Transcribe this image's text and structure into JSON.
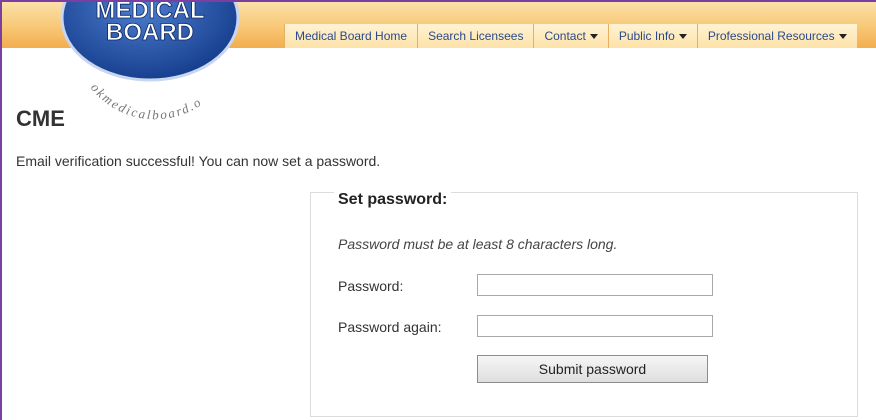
{
  "logo": {
    "line1": "MEDICAL",
    "line2": "BOARD",
    "arc_text": "okmedicalboard.o"
  },
  "nav": {
    "items": [
      {
        "label": "Medical Board Home",
        "dropdown": false
      },
      {
        "label": "Search Licensees",
        "dropdown": false
      },
      {
        "label": "Contact",
        "dropdown": true
      },
      {
        "label": "Public Info",
        "dropdown": true
      },
      {
        "label": "Professional Resources",
        "dropdown": true
      }
    ]
  },
  "page": {
    "title": "CME",
    "message": "Email verification successful! You can now set a password."
  },
  "form": {
    "legend": "Set password:",
    "note": "Password must be at least 8 characters long.",
    "password_label": "Password:",
    "password_value": "",
    "password_again_label": "Password again:",
    "password_again_value": "",
    "submit_label": "Submit password"
  },
  "colors": {
    "header_orange": "#f8c877",
    "logo_blue": "#1f4fa8",
    "nav_text": "#2a4a8c",
    "frame_purple": "#7a3fa0"
  }
}
